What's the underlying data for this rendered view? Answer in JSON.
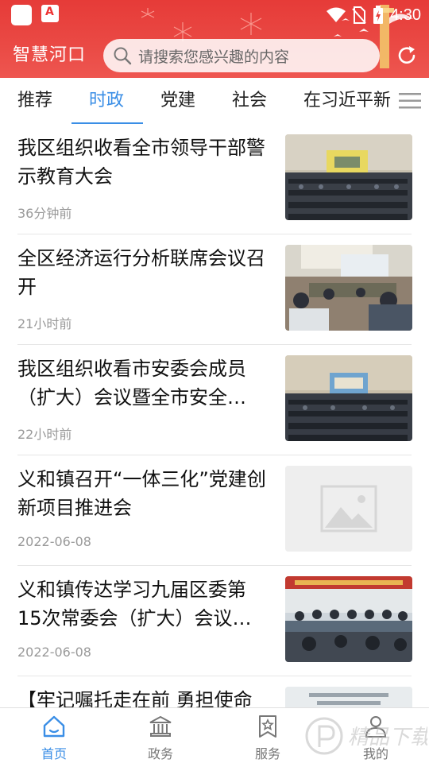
{
  "status_bar": {
    "time": "4:30",
    "icons": [
      "app-icon",
      "acrobat-icon",
      "wifi-icon",
      "no-sim-icon",
      "battery-charging-icon"
    ]
  },
  "header": {
    "app_title": "智慧河口",
    "search_placeholder": "请搜索您感兴趣的内容",
    "refresh_icon": "refresh-icon",
    "accent_color": "#e63b38"
  },
  "tabs": {
    "items": [
      {
        "label": "推荐",
        "active": false
      },
      {
        "label": "时政",
        "active": true
      },
      {
        "label": "党建",
        "active": false
      },
      {
        "label": "社会",
        "active": false
      },
      {
        "label": "在习近平新",
        "active": false
      }
    ],
    "active_color": "#3a8ee6",
    "menu_icon": "menu-icon"
  },
  "news": [
    {
      "title": "我区组织收看全市领导干部警示教育大会",
      "time": "36分钟前",
      "thumb": "meeting-hall-photo"
    },
    {
      "title": "全区经济运行分析联席会议召开",
      "time": "21小时前",
      "thumb": "conference-table-photo"
    },
    {
      "title": "我区组织收看市安委会成员（扩大）会议暨全市安全…",
      "time": "22小时前",
      "thumb": "meeting-hall-photo"
    },
    {
      "title": "义和镇召开“一体三化”党建创新项目推进会",
      "time": "2022-06-08",
      "thumb": "image-placeholder"
    },
    {
      "title": "义和镇传达学习九届区委第15次常委会（扩大）会议…",
      "time": "2022-06-08",
      "thumb": "meeting-room-photo"
    },
    {
      "title": "【牢记嘱托走在前 勇担使命",
      "time": "",
      "thumb": "document-photo"
    }
  ],
  "bottom_nav": [
    {
      "label": "首页",
      "icon": "home-icon",
      "active": true
    },
    {
      "label": "政务",
      "icon": "government-icon",
      "active": false
    },
    {
      "label": "服务",
      "icon": "bookmark-star-icon",
      "active": false
    },
    {
      "label": "我的",
      "icon": "user-icon",
      "active": false
    }
  ],
  "watermark": "精品下载"
}
